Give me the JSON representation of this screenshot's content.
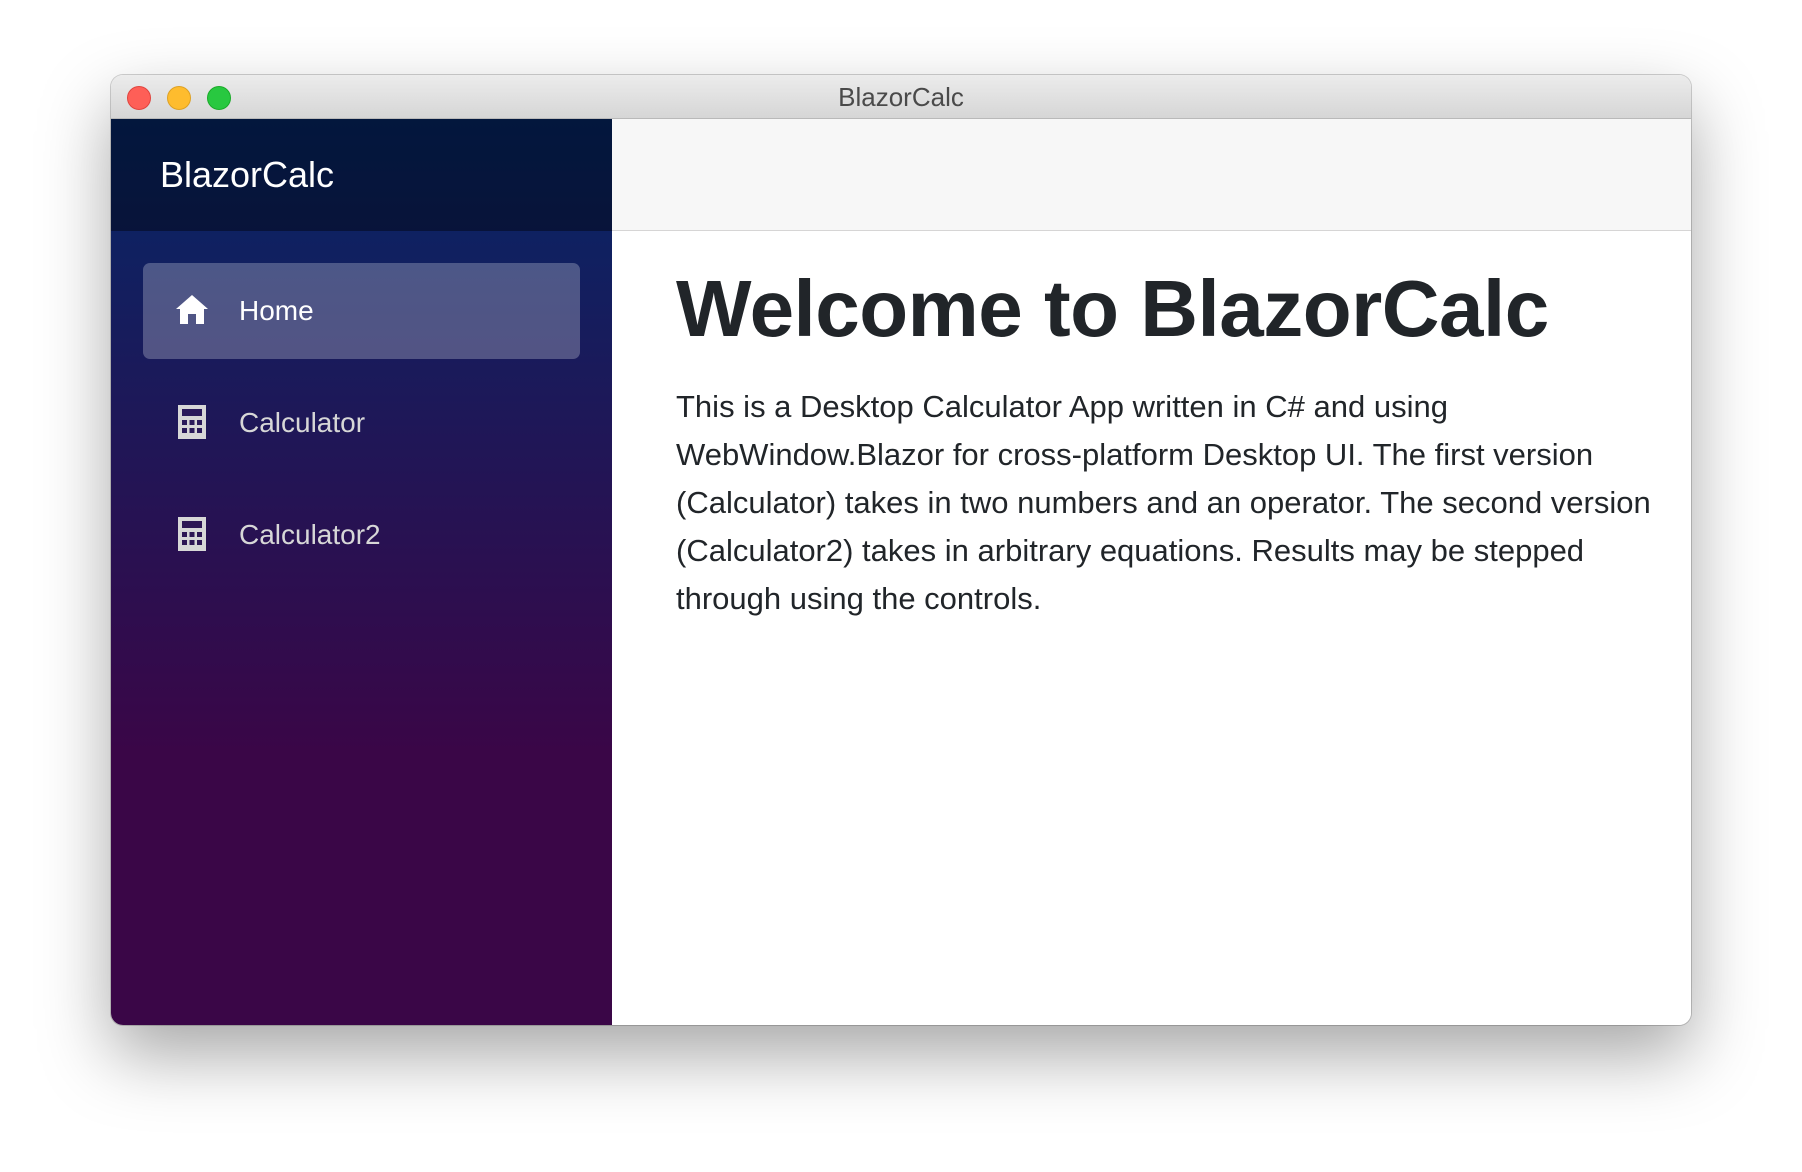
{
  "window": {
    "title": "BlazorCalc"
  },
  "sidebar": {
    "brand": "BlazorCalc",
    "items": [
      {
        "label": "Home",
        "icon": "home-icon",
        "active": true
      },
      {
        "label": "Calculator",
        "icon": "calculator-icon",
        "active": false
      },
      {
        "label": "Calculator2",
        "icon": "calculator-icon",
        "active": false
      }
    ]
  },
  "main": {
    "heading": "Welcome to BlazorCalc",
    "body": "This is a Desktop Calculator App written in C# and using WebWindow.Blazor for cross-platform Desktop UI. The first version (Calculator) takes in two numbers and an operator. The second version (Calculator2) takes in arbitrary equations. Results may be stepped through using the controls."
  },
  "colors": {
    "sidebar_top": "#052767",
    "sidebar_bottom": "#3a0647",
    "close": "#fe5f57",
    "minimize": "#febc2e",
    "zoom": "#28c840",
    "text": "#212529"
  }
}
